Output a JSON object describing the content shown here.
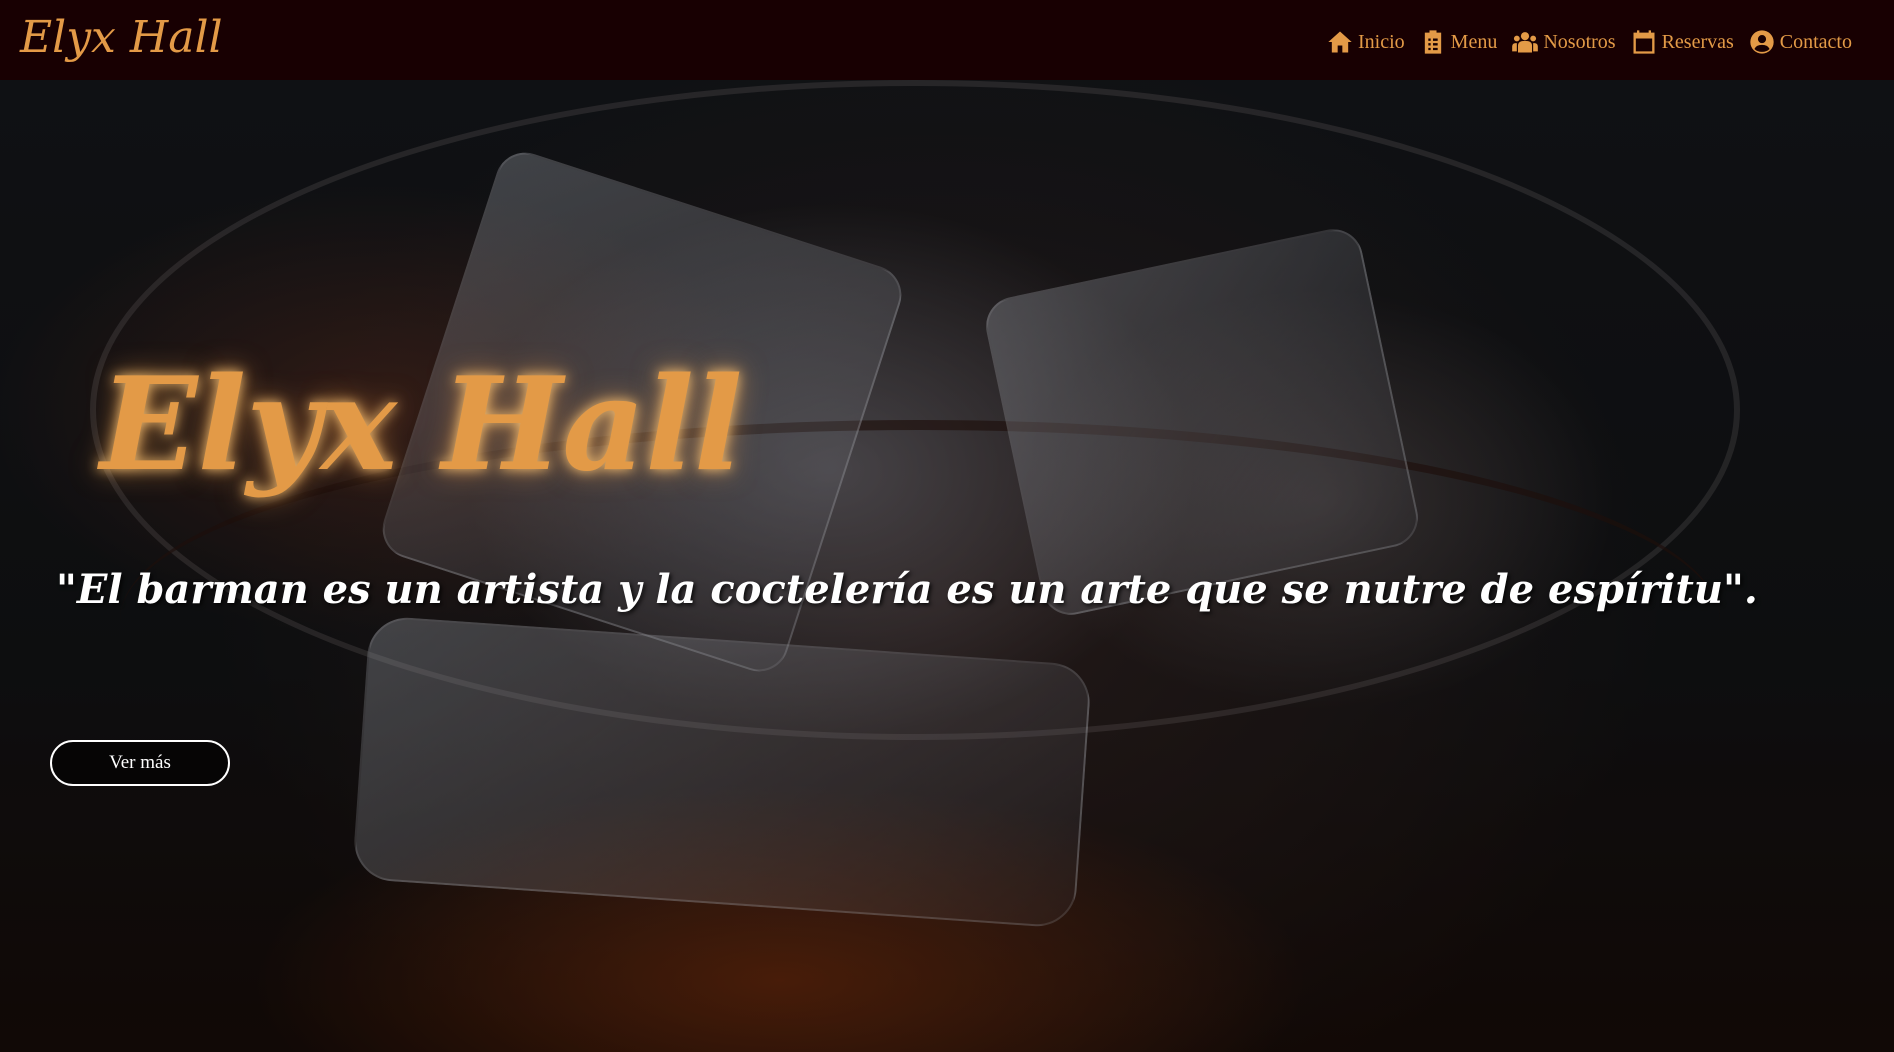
{
  "navbar": {
    "brand": "Elyx Hall",
    "links": [
      {
        "label": "Inicio",
        "icon": "home-icon"
      },
      {
        "label": "Menu",
        "icon": "clipboard-list-icon"
      },
      {
        "label": "Nosotros",
        "icon": "users-icon"
      },
      {
        "label": "Reservas",
        "icon": "calendar-check-icon"
      },
      {
        "label": "Contacto",
        "icon": "user-circle-icon"
      }
    ]
  },
  "hero": {
    "title": "Elyx Hall",
    "quote": "\"El barman es un artista y la coctelería es un arte que se nutre de espíritu\".",
    "button_label": "Ver más"
  },
  "colors": {
    "accent": "#e39a47",
    "navbar_bg": "#180002",
    "text_light": "#ffffff"
  }
}
